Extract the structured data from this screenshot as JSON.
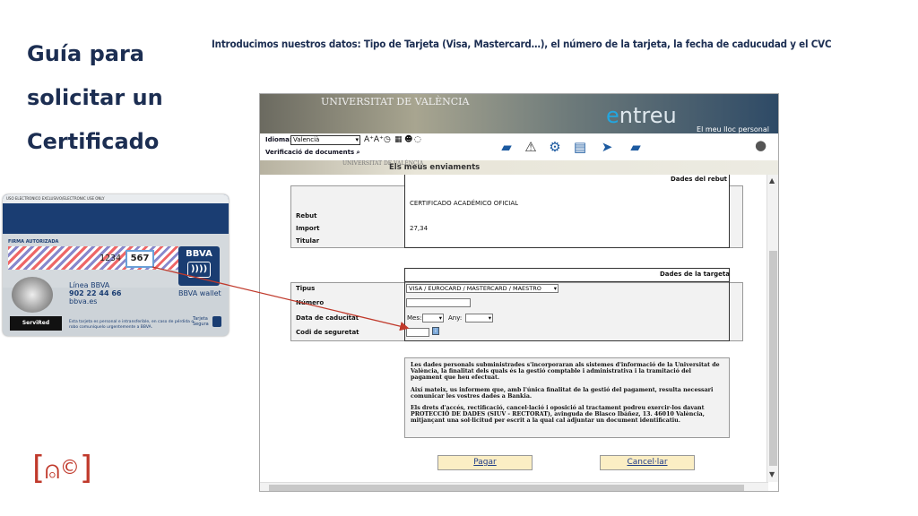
{
  "slide": {
    "title_lines": [
      "Guía para",
      "solicitar un",
      "Certificado"
    ],
    "intro": "Introducimos nuestros datos: Tipo de Tarjeta (Visa, Mastercard…), el número de la tarjeta, la fecha de caducudad y el CVC"
  },
  "card": {
    "strip_text": "USO ELECTRONICO EXCLUSIVO/ELECTRONIC USE ONLY",
    "signature_label": "FIRMA AUTORIZADA",
    "number_partial": "1234",
    "cvc": "567",
    "brand": "BBVA",
    "wallet": "BBVA wallet",
    "linea_lines": [
      "Línea BBVA",
      "902 22 44 66",
      "bbva.es"
    ],
    "servired": "ServiRed",
    "fine_print": "Esta tarjeta es personal e intransferible, en caso de pérdida o robo comuníquelo urgentemente a BBVA.",
    "tarjeta_segura": "Tarjeta Segura"
  },
  "app": {
    "header": {
      "university": "UNIVERSITAT DE VALÈNCIA",
      "brand_e": "e",
      "brand_rest": "ntreu",
      "personal": "El meu lloc personal"
    },
    "toolbar": {
      "idioma_label": "Idioma:",
      "idioma_value": "Valencià",
      "verificacio": "Verificació de documents"
    },
    "section_title": "Els meus enviaments",
    "rebut": {
      "heading": "Dades del rebut",
      "concept": "CERTIFICADO ACADÉMICO OFICIAL",
      "rebut_label": "Rebut",
      "import_label": "Import",
      "import_value": "27,34",
      "titular_label": "Titular"
    },
    "targeta": {
      "heading": "Dades de la targeta",
      "tipus_label": "Tipus",
      "tipus_value": "VISA / EUROCARD / MASTERCARD / MAESTRO",
      "numero_label": "Número",
      "data_label": "Data de caducitat",
      "mes_label": "Mes:",
      "any_label": "Any:",
      "codi_label": "Codi de seguretat"
    },
    "privacy": [
      "Les dades personals subministrades s'incorporaran als sistemes d'informació de la Universitat de València, la finalitat dels quals és la gestió comptable i administrativa i la tramitació del pagament que heu efectuat.",
      "Així mateix, us informem que, amb l'única finalitat de la gestió del pagament, resulta necessari comunicar les vostres dades a Bankia.",
      "Els drets d'accés, rectificació, cancel·lació i oposició al tractament podreu exercir-los davant PROTECCIÓ DE DADES (SIUV - RECTORAT), avinguda de Blasco Ibáñez, 13. 46010 València, mitjançant una sol·licitud per escrit a la qual cal adjuntar un document identificatiu."
    ],
    "pagar": "Pagar",
    "cancel": "Cancel·lar"
  },
  "colors": {
    "title": "#1c2e52",
    "arrow": "#c0392b",
    "button_bg": "#fbeec4",
    "bank_blue": "#1a3d72"
  }
}
